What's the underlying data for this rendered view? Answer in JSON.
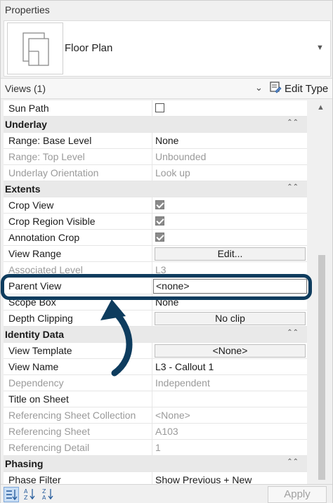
{
  "panel": {
    "title": "Properties"
  },
  "type_selector": {
    "name": "Floor Plan",
    "thumb_icon": "floor-plan-icon",
    "dropdown_icon": "chevron-down-icon"
  },
  "filter": {
    "label": "Views (1)",
    "edit_type_label": "Edit Type"
  },
  "rows": [
    {
      "kind": "prop",
      "name": "Sun Path",
      "control": "checkbox",
      "checked": false
    },
    {
      "kind": "section",
      "name": "Underlay"
    },
    {
      "kind": "prop",
      "name": "Range: Base Level",
      "value": "None"
    },
    {
      "kind": "prop",
      "name": "Range: Top Level",
      "value": "Unbounded",
      "disabled": true
    },
    {
      "kind": "prop",
      "name": "Underlay Orientation",
      "value": "Look up",
      "disabled": true
    },
    {
      "kind": "section",
      "name": "Extents"
    },
    {
      "kind": "prop",
      "name": "Crop View",
      "control": "checkbox",
      "checked": true
    },
    {
      "kind": "prop",
      "name": "Crop Region Visible",
      "control": "checkbox",
      "checked": true
    },
    {
      "kind": "prop",
      "name": "Annotation Crop",
      "control": "checkbox",
      "checked": true
    },
    {
      "kind": "prop",
      "name": "View Range",
      "control": "button",
      "value": "Edit..."
    },
    {
      "kind": "prop",
      "name": "Associated Level",
      "value": "L3",
      "disabled": true
    },
    {
      "kind": "prop",
      "name": "Parent View",
      "control": "input",
      "value": "<none>"
    },
    {
      "kind": "prop",
      "name": "Scope Box",
      "value": "None"
    },
    {
      "kind": "prop",
      "name": "Depth Clipping",
      "control": "button",
      "value": "No clip"
    },
    {
      "kind": "section",
      "name": "Identity Data"
    },
    {
      "kind": "prop",
      "name": "View Template",
      "control": "button",
      "value": "<None>"
    },
    {
      "kind": "prop",
      "name": "View Name",
      "value": "L3 - Callout 1"
    },
    {
      "kind": "prop",
      "name": "Dependency",
      "value": "Independent",
      "disabled": true
    },
    {
      "kind": "prop",
      "name": "Title on Sheet",
      "value": ""
    },
    {
      "kind": "prop",
      "name": "Referencing Sheet Collection",
      "value": "<None>",
      "disabled": true
    },
    {
      "kind": "prop",
      "name": "Referencing Sheet",
      "value": "A103",
      "disabled": true
    },
    {
      "kind": "prop",
      "name": "Referencing Detail",
      "value": "1",
      "disabled": true
    },
    {
      "kind": "section",
      "name": "Phasing"
    },
    {
      "kind": "prop",
      "name": "Phase Filter",
      "value": "Show Previous + New"
    }
  ],
  "bottom": {
    "apply_label": "Apply",
    "sort_icons": [
      "categorized-sort-icon",
      "sort-ascending-icon",
      "sort-descending-icon"
    ]
  },
  "colors": {
    "highlight": "#0e3c5e",
    "disabled_text": "#9a9a9a",
    "section_bg": "#e9e9e9"
  }
}
